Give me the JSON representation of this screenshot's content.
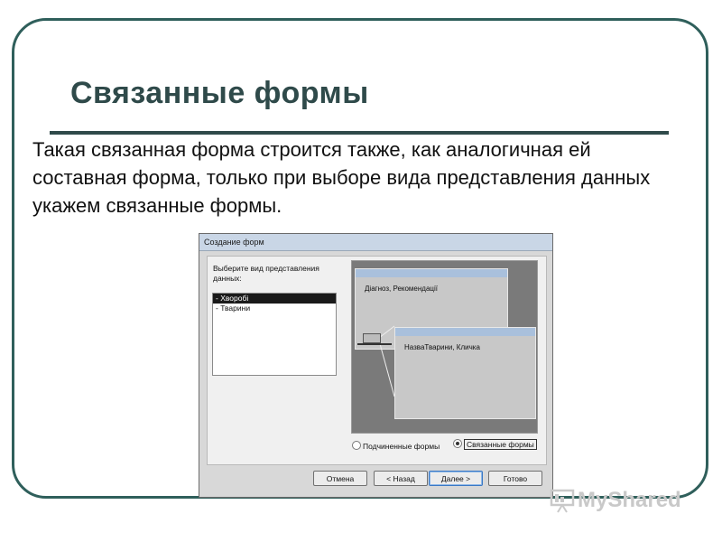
{
  "slide": {
    "title": "Связанные формы",
    "text": "Такая связанная форма строится также, как аналогичная ей составная форма, только при выборе вида представления данных укажем связанные формы."
  },
  "dialog": {
    "title": "Создание форм",
    "prompt": "Выберите вид представления данных:",
    "list_items": [
      "- Хворобі",
      "- Тварини"
    ],
    "selected_index": 0,
    "preview": {
      "main_form_label": "Діагноз, Рекомендації",
      "sub_form_label": "НазваТварини, Кличка"
    },
    "radio_subforms": "Подчиненные формы",
    "radio_linked": "Связанные формы",
    "radio_selected": "linked",
    "buttons": {
      "cancel": "Отмена",
      "back": "< Назад",
      "next": "Далее >",
      "finish": "Готово"
    }
  },
  "watermark": {
    "text": "MyShared"
  }
}
